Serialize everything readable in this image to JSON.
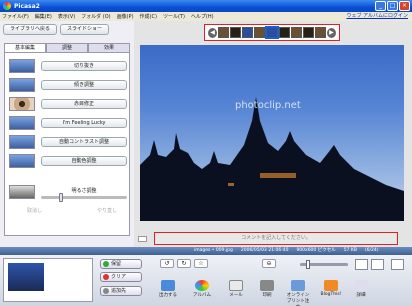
{
  "window": {
    "title": "Picasa2"
  },
  "menu": [
    "ファイル(F)",
    "編集(E)",
    "表示(V)",
    "フォルダ (O)",
    "画像(P)",
    "作成(C)",
    "ツール(T)",
    "ヘルプ(H)"
  ],
  "header": {
    "web_album_link": "ウェブ アルバムにログイン"
  },
  "left": {
    "back_label": "ライブラリへ戻る",
    "slideshow_label": "スライドショー",
    "tabs": [
      "基本編集",
      "調整",
      "効果"
    ],
    "tools": [
      "切り抜き",
      "傾き調整",
      "赤目修正",
      "I'm Feeling Lucky",
      "自動コントラスト調整",
      "自動色調整"
    ],
    "slider_label": "明るさ調整",
    "undo_label": "取消し",
    "redo_label": "やり直し"
  },
  "viewer": {
    "watermark": "photoclip.net",
    "comment_placeholder": "コメントを記入してください。"
  },
  "status": {
    "filename": "images • 009.jpg",
    "datetime": "2006/05/03 21:06:40",
    "dimensions": "900x600 ピクセル",
    "filesize": "57 KB",
    "index": "(6/24)"
  },
  "tray": {
    "hold_label": "保留",
    "clear_label": "クリア",
    "add_label": "追加先"
  },
  "actions": [
    "出力する",
    "アルバム",
    "メール",
    "印刷",
    "オンラインプリント注文",
    "BlogThis!",
    "詳細"
  ],
  "colors": {
    "titlebar": "#0a4fd6",
    "highlight_box": "#dd2222",
    "status_bar": "#3d5f95"
  }
}
